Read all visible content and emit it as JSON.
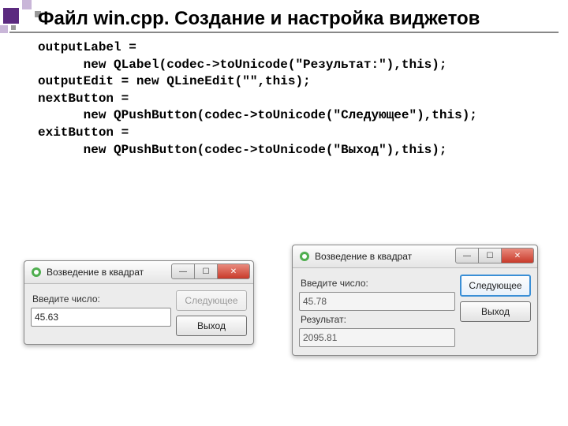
{
  "slide": {
    "title": "Файл win.cpp. Создание и настройка виджетов"
  },
  "code": {
    "line1": "outputLabel =",
    "line2": "      new QLabel(codec->toUnicode(\"Результат:\"),this);",
    "line3": "outputEdit = new QLineEdit(\"\",this);",
    "line4": "nextButton =",
    "line5": "      new QPushButton(codec->toUnicode(\"Следующее\"),this);",
    "line6": "exitButton =",
    "line7": "      new QPushButton(codec->toUnicode(\"Выход\"),this);"
  },
  "win1": {
    "title": "Возведение в квадрат",
    "label_input": "Введите число:",
    "value_input": "45.63",
    "btn_next": "Следующее",
    "btn_exit": "Выход"
  },
  "win2": {
    "title": "Возведение в квадрат",
    "label_input": "Введите число:",
    "value_input": "45.78",
    "label_result": "Результат:",
    "value_result": "2095.81",
    "btn_next": "Следующее",
    "btn_exit": "Выход"
  },
  "glyphs": {
    "minimize": "—",
    "maximize": "☐",
    "close": "✕"
  }
}
